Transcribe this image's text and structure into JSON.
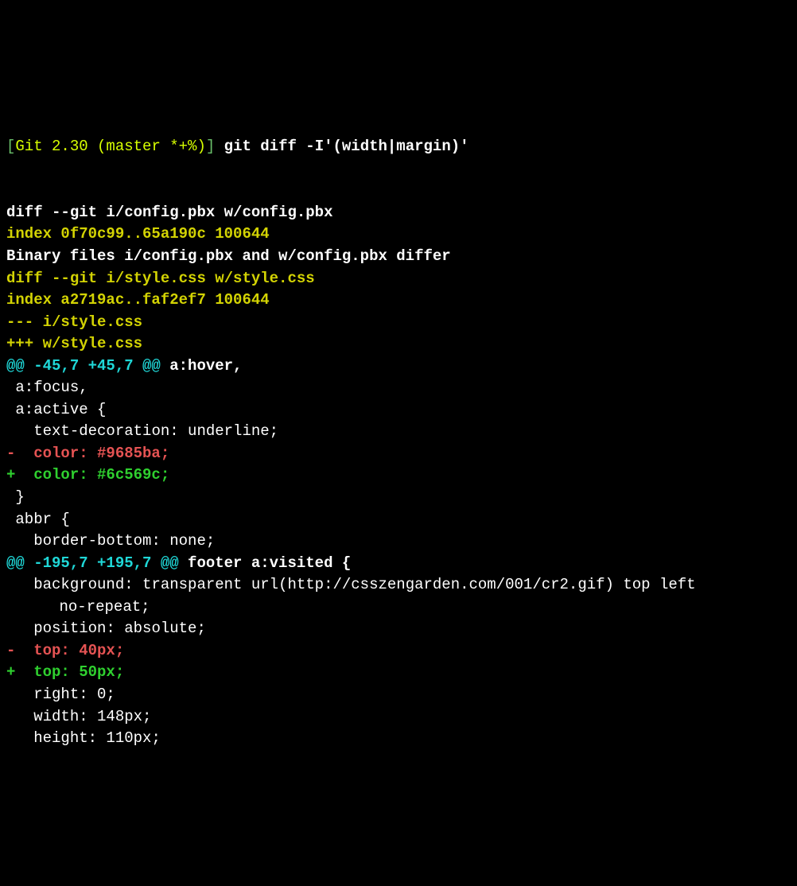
{
  "prompt": {
    "open_bracket": "[",
    "version": "Git 2.30",
    "branch": "(master *+%)",
    "close_bracket": "]",
    "command": "git diff -I'(width|margin)'"
  },
  "lines": [
    {
      "type": "white-bold",
      "text": "diff --git i/config.pbx w/config.pbx"
    },
    {
      "type": "yellow-bold",
      "text": "index 0f70c99..65a190c 100644"
    },
    {
      "type": "white-bold",
      "text": "Binary files i/config.pbx and w/config.pbx differ"
    },
    {
      "type": "yellow-bold",
      "text": "diff --git i/style.css w/style.css"
    },
    {
      "type": "yellow-bold",
      "text": "index a2719ac..faf2ef7 100644"
    },
    {
      "type": "yellow-bold",
      "text": "--- i/style.css"
    },
    {
      "type": "yellow-bold",
      "text": "+++ w/style.css"
    },
    {
      "type": "hunk",
      "hunk": "@@ -45,7 +45,7 @@",
      "tail": " a:hover,"
    },
    {
      "type": "context",
      "text": " a:focus,"
    },
    {
      "type": "context",
      "text": " a:active {"
    },
    {
      "type": "context",
      "text": "   text-decoration: underline;"
    },
    {
      "type": "removed",
      "text": "-  color: #9685ba;"
    },
    {
      "type": "added",
      "text": "+  color: #6c569c;"
    },
    {
      "type": "context",
      "text": " }"
    },
    {
      "type": "context",
      "text": " abbr {"
    },
    {
      "type": "context",
      "text": "   border-bottom: none;"
    },
    {
      "type": "hunk",
      "hunk": "@@ -195,7 +195,7 @@",
      "tail": " footer a:visited {"
    },
    {
      "type": "context-wrap",
      "text": "   background: transparent url(http://csszengarden.com/001/cr2.gif) top left",
      "cont": "no-repeat;"
    },
    {
      "type": "context",
      "text": "   position: absolute;"
    },
    {
      "type": "removed",
      "text": "-  top: 40px;"
    },
    {
      "type": "added",
      "text": "+  top: 50px;"
    },
    {
      "type": "context",
      "text": "   right: 0;"
    },
    {
      "type": "context",
      "text": "   width: 148px;"
    },
    {
      "type": "context",
      "text": "   height: 110px;"
    }
  ]
}
